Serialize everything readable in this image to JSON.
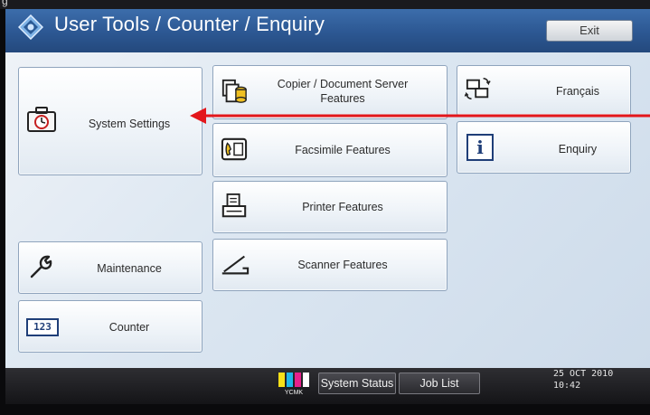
{
  "header": {
    "title": "User Tools / Counter / Enquiry",
    "exit_label": "Exit"
  },
  "edge_text": "g",
  "left_column": [
    {
      "label": "System Settings",
      "icon": "toolbox-clock-icon"
    },
    {
      "label": "Maintenance",
      "icon": "wrench-icon"
    },
    {
      "label": "Counter",
      "icon": "counter-123-icon"
    }
  ],
  "middle_column": [
    {
      "label": "Copier / Document Server Features",
      "icon": "copier-document-server-icon"
    },
    {
      "label": "Facsimile Features",
      "icon": "fax-icon"
    },
    {
      "label": "Printer Features",
      "icon": "printer-icon"
    },
    {
      "label": "Scanner Features",
      "icon": "scanner-icon"
    }
  ],
  "right_column": [
    {
      "label": "Français",
      "icon": "language-switch-icon"
    },
    {
      "label": "Enquiry",
      "icon": "info-icon"
    }
  ],
  "counter_icon_text": "123",
  "statusbar": {
    "ymck": "YCMK",
    "system_status_label": "System Status",
    "job_list_label": "Job List",
    "date": "25 OCT  2010",
    "time": "10:42"
  },
  "colors": {
    "title_bar": "#2c5792",
    "panel": "#dbe6f1",
    "button_border": "#8fa4bd",
    "annotation_arrow": "#e3161b",
    "status_bar": "#1e1e22"
  }
}
